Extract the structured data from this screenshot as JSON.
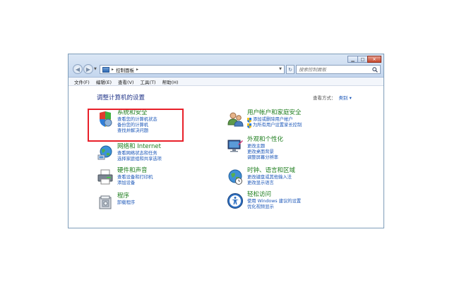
{
  "address": {
    "path": "控制面板"
  },
  "search": {
    "placeholder": "搜索控制面板"
  },
  "menu": [
    "文件(F)",
    "编辑(E)",
    "查看(V)",
    "工具(T)",
    "帮助(H)"
  ],
  "page_title": "调整计算机的设置",
  "view_by": {
    "label": "查看方式：",
    "value": "类别 ▾"
  },
  "categories": {
    "system_security": {
      "title": "系统和安全",
      "links": [
        "查看您的计算机状态",
        "备份您的计算机",
        "查找并解决问题"
      ]
    },
    "network": {
      "title": "网络和 Internet",
      "links": [
        "查看网络状态和任务",
        "选择家庭组和共享选项"
      ]
    },
    "hardware": {
      "title": "硬件和声音",
      "links": [
        "查看设备和打印机",
        "添加设备"
      ]
    },
    "programs": {
      "title": "程序",
      "links": [
        "卸载程序"
      ]
    },
    "user_accounts": {
      "title": "用户帐户和家庭安全",
      "links": [
        "添加或删除用户帐户",
        "为所有用户设置家长控制"
      ]
    },
    "appearance": {
      "title": "外观和个性化",
      "links": [
        "更改主题",
        "更改桌面背景",
        "调整屏幕分辨率"
      ]
    },
    "clock": {
      "title": "时钟、语言和区域",
      "links": [
        "更改键盘或其他输入法",
        "更改显示语言"
      ]
    },
    "ease": {
      "title": "轻松访问",
      "links": [
        "使用 Windows 建议的设置",
        "优化视频显示"
      ]
    }
  },
  "colors": {
    "highlight": "#e8202a",
    "category_title": "#1d7d1d",
    "link": "#1a56b8"
  }
}
